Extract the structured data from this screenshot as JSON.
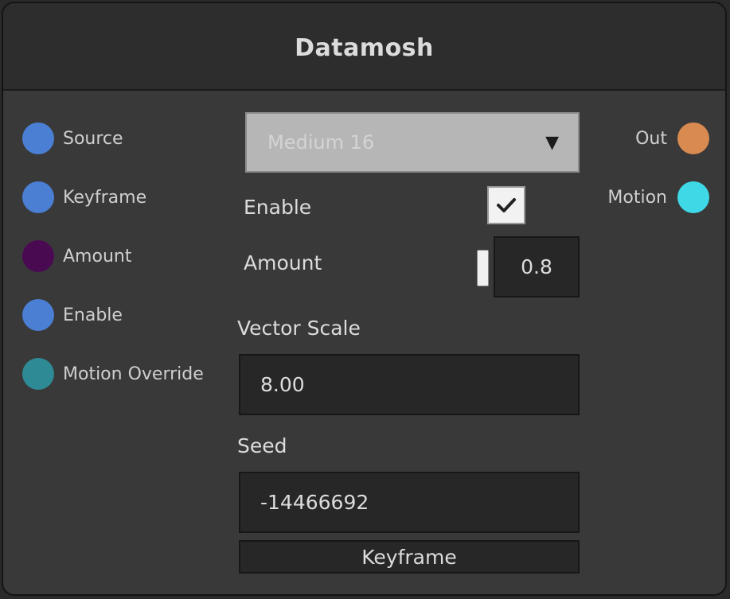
{
  "node": {
    "title": "Datamosh"
  },
  "inputs": [
    {
      "label": "Source",
      "color": "#4a7fd4"
    },
    {
      "label": "Keyframe",
      "color": "#4a7fd4"
    },
    {
      "label": "Amount",
      "color": "#4a0a52"
    },
    {
      "label": "Enable",
      "color": "#4a7fd4"
    },
    {
      "label": "Motion Override",
      "color": "#2e8a94"
    }
  ],
  "outputs": [
    {
      "label": "Out",
      "color": "#d98a50"
    },
    {
      "label": "Motion",
      "color": "#3fd8e6"
    }
  ],
  "controls": {
    "mode": {
      "selected": "Medium 16",
      "arrow_icon": "triangle-down-icon"
    },
    "enable": {
      "label": "Enable",
      "checked": true
    },
    "amount": {
      "label": "Amount",
      "value": "0.8"
    },
    "vector_scale": {
      "label": "Vector Scale",
      "value": "8.00"
    },
    "seed": {
      "label": "Seed",
      "value": "-14466692"
    },
    "keyframe_button": {
      "label": "Keyframe"
    }
  }
}
